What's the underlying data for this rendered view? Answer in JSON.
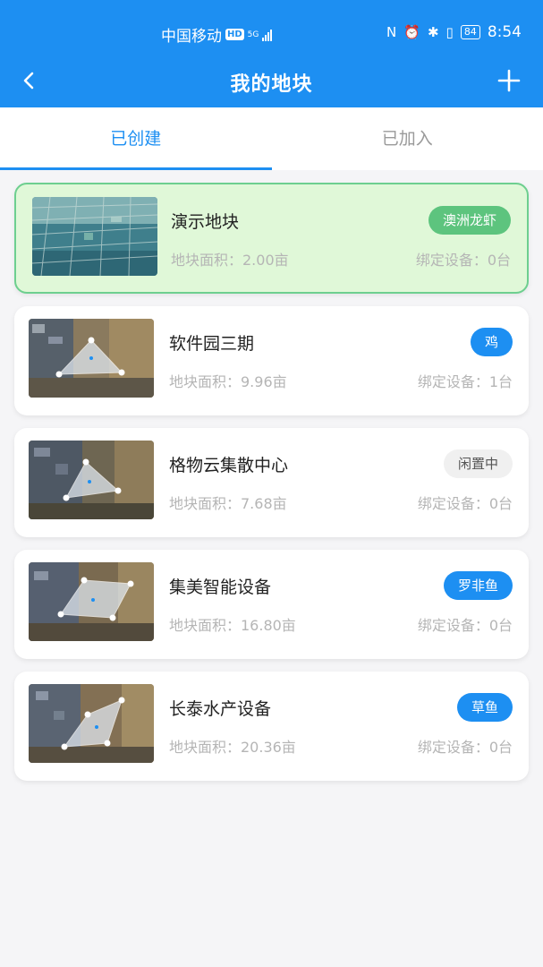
{
  "status_bar": {
    "carrier": "中国移动",
    "hd": "HD",
    "network": "5G",
    "battery": "84",
    "time": "8:54"
  },
  "navbar": {
    "title": "我的地块",
    "back_icon": "chevron-left-icon",
    "add_icon": "plus-icon"
  },
  "tabs": [
    {
      "label": "已创建",
      "active": true
    },
    {
      "label": "已加入",
      "active": false
    }
  ],
  "plots": [
    {
      "name": "演示地块",
      "area": "地块面积：2.00亩",
      "devices": "绑定设备：0台",
      "tag": "澳洲龙虾",
      "tag_color": "#5dc47e"
    },
    {
      "name": "软件园三期",
      "area": "地块面积：9.96亩",
      "devices": "绑定设备：1台",
      "tag": "鸡",
      "tag_color": "#1d8ff2"
    },
    {
      "name": "格物云集散中心",
      "area": "地块面积：7.68亩",
      "devices": "绑定设备：0台",
      "tag": "闲置中",
      "tag_color": "#f0f0f0"
    },
    {
      "name": "集美智能设备",
      "area": "地块面积：16.80亩",
      "devices": "绑定设备：0台",
      "tag": "罗非鱼",
      "tag_color": "#1d8ff2"
    },
    {
      "name": "长泰水产设备",
      "area": "地块面积：20.36亩",
      "devices": "绑定设备：0台",
      "tag": "草鱼",
      "tag_color": "#1d8ff2"
    }
  ],
  "colors": {
    "primary": "#1d8ff2",
    "demo_card_bg": "#e0f8d8",
    "demo_card_border": "#6dcf8f"
  }
}
